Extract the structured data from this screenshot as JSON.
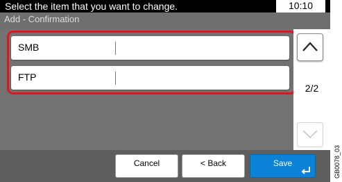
{
  "header": {
    "message": "Select the item that you want to change.",
    "time": "10:10"
  },
  "subheader": {
    "title": "Add - Confirmation"
  },
  "items": [
    {
      "label": "SMB",
      "value": ""
    },
    {
      "label": "FTP",
      "value": ""
    }
  ],
  "pager": {
    "page": "2/2"
  },
  "footer": {
    "cancel_label": "Cancel",
    "back_label": "< Back",
    "save_label": "Save"
  },
  "figure_code": "GB0078_03",
  "colors": {
    "highlight": "#e3141b",
    "save_button": "#0a82d8"
  },
  "icons": {
    "scroll_up": "chevron-up-icon",
    "scroll_down": "chevron-down-icon",
    "enter": "enter-icon"
  }
}
